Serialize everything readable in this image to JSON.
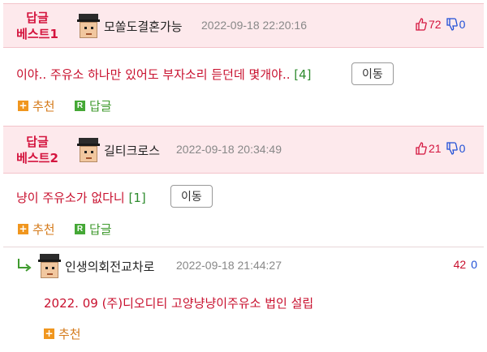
{
  "comments": [
    {
      "best_label_line1": "답글",
      "best_label_line2": "베스트1",
      "nickname": "모쏠도결혼가능",
      "date": "2022-09-18 22:20:16",
      "up_votes": "72",
      "down_votes": "0",
      "text": "이야.. 주유소 하나만 있어도 부자소리 듣던데 몇개야..",
      "reply_count": "[4]",
      "move_label": "이동",
      "recommend_label": "추천",
      "reply_label": "답글"
    },
    {
      "best_label_line1": "답글",
      "best_label_line2": "베스트2",
      "nickname": "길티크로스",
      "date": "2022-09-18 20:34:49",
      "up_votes": "21",
      "down_votes": "0",
      "text": "냥이 주유소가 없다니",
      "reply_count": "[1]",
      "move_label": "이동",
      "recommend_label": "추천",
      "reply_label": "답글"
    }
  ],
  "reply": {
    "nickname": "인생의회전교차로",
    "date": "2022-09-18 21:44:27",
    "up_votes": "42",
    "down_votes": "0",
    "text": "2022. 09 (주)디오디티 고양냥냥이주유소 법인 설립",
    "recommend_label": "추천"
  },
  "icons": {
    "plus_box": "+",
    "r_box": "R"
  },
  "colors": {
    "best_header_bg": "#fde9ec",
    "best_label": "#d4143e",
    "comment_text": "#c8102e",
    "reply_count": "#2e8b2e",
    "recommend": "#d47a1a",
    "reply_action": "#3f9a2e",
    "down_vote": "#1f4fd6"
  }
}
